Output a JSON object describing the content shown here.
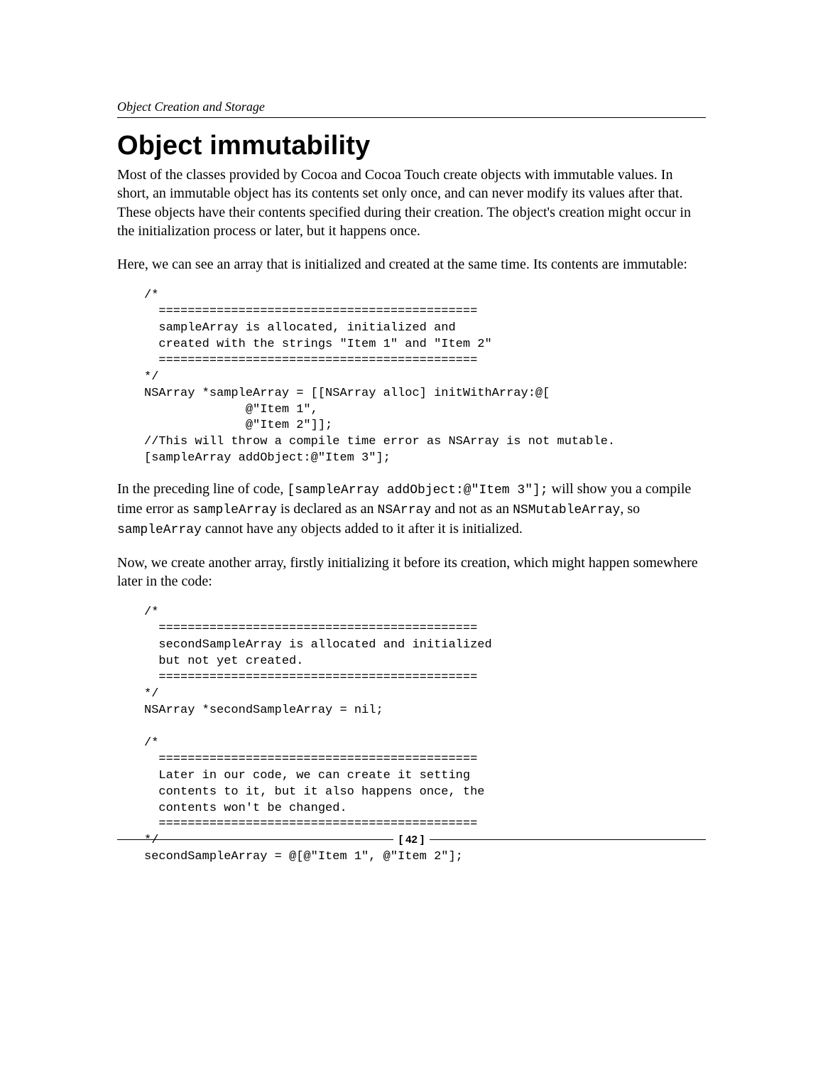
{
  "header": {
    "running_title": "Object Creation and Storage"
  },
  "title": "Object immutability",
  "paragraphs": {
    "p1": "Most of the classes provided by Cocoa and Cocoa Touch create objects with immutable values. In short, an immutable object has its contents set only once, and can never modify its values after that. These objects have their contents specified during their creation. The object's creation might occur in the initialization process or later, but it happens once.",
    "p2": "Here, we can see an array that is initialized and created at the same time. Its contents are immutable:",
    "p3_a": "In the preceding line of code, ",
    "p3_code1": "[sampleArray addObject:@\"Item 3\"];",
    "p3_b": " will show you a compile time error as ",
    "p3_code2": "sampleArray",
    "p3_c": " is declared as an ",
    "p3_code3": "NSArray",
    "p3_d": " and not as an ",
    "p3_code4": "NSMutableArray",
    "p3_e": ", so ",
    "p3_code5": "sampleArray",
    "p3_f": " cannot have any objects added to it after it is initialized.",
    "p4": "Now, we create another array, firstly initializing it before its creation, which might happen somewhere later in the code:"
  },
  "code_blocks": {
    "c1": "/*\n  ============================================\n  sampleArray is allocated, initialized and\n  created with the strings \"Item 1\" and \"Item 2\"\n  ============================================\n*/\nNSArray *sampleArray = [[NSArray alloc] initWithArray:@[\n              @\"Item 1\",\n              @\"Item 2\"]];\n//This will throw a compile time error as NSArray is not mutable.\n[sampleArray addObject:@\"Item 3\"];",
    "c2": "/*\n  ============================================\n  secondSampleArray is allocated and initialized\n  but not yet created.\n  ============================================\n*/\nNSArray *secondSampleArray = nil;\n\n/*\n  ============================================\n  Later in our code, we can create it setting\n  contents to it, but it also happens once, the\n  contents won't be changed.\n  ============================================\n*/\nsecondSampleArray = @[@\"Item 1\", @\"Item 2\"];"
  },
  "footer": {
    "page_number": "[ 42 ]"
  }
}
